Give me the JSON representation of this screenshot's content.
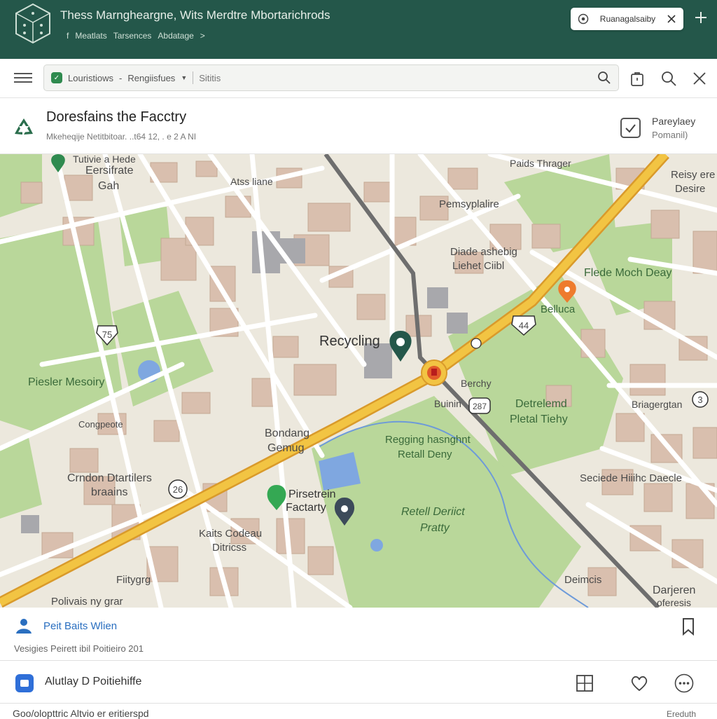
{
  "header": {
    "title": "Thess Marngheargne, Wits Merdtre Mbortarichrods",
    "menu": [
      "f",
      "Meatlats",
      "Tarsences",
      "Abdatage",
      ">"
    ],
    "tab_label": "Ruanagalsaiby",
    "tab_icon": "compass-icon",
    "close_icon": "close-icon",
    "plus_icon": "plus-icon"
  },
  "toolbar": {
    "search_category": "Louristiows",
    "search_sep": "-",
    "search_filter": "Rengiisfues",
    "search_placeholder": "Sititis",
    "icons": [
      "menu-icon",
      "search-icon",
      "bag-icon",
      "search-icon",
      "close-icon"
    ]
  },
  "place": {
    "title": "Doresfains the Facctry",
    "subtitle": "Mkeheqije Netitbitoar. ..t64 12, . e 2 A NI",
    "save_label_line1": "Pareylaey",
    "save_label_line2": "Pomanil)"
  },
  "map": {
    "labels": {
      "top_left_poi": "Tutivie a Hede",
      "estate": "Eersifrate",
      "estate2": "Gah",
      "atss": "Atss liane",
      "plaids": "Paids Thrager",
      "reisy": "Reisy ere",
      "desire": "Desire",
      "pemsy": "Pemsyplalire",
      "diade": "Diade ashebig",
      "liehet": "Liehet Ciibl",
      "flede": "Flede Moch Deay",
      "belluca": "Belluca",
      "recycling": "Recycling",
      "pieslet": "Piesler Mesoiry",
      "conpeote": "Congpeote",
      "bonding": "Bondang",
      "gemug": "Gemug",
      "berchy": "Berchy",
      "buinin": "Buinin",
      "detrelemd": "Detrelemd",
      "pletal": "Pletal Tiehy",
      "briagerstan": "Briagergtan",
      "regging": "Regging hasnghnt",
      "retall": "Retall Deny",
      "crndon": "Crndon Dtartilers",
      "brains": "braains",
      "pirsetrein": "Pirsetrein",
      "factarty": "Factarty",
      "retell_district": "Retell Deriict",
      "pratty": "Pratty",
      "kaits": "Kaits Codeau",
      "ditricss": "Ditricss",
      "fiitygrg": "Fiitygrg",
      "polivais": "Polivais ny grar",
      "seciede": "Seciede Hiiihc Daecle",
      "deimcis": "Deimcis",
      "darjeren": "Darjeren",
      "oferesis": "oferesis"
    },
    "shields": [
      "75",
      "44",
      "26",
      "287",
      "3"
    ]
  },
  "list": {
    "row1_title": "Peit Baits Wlien",
    "row1_sub": "Vesigies Peirett ibil Poitieiro 201",
    "row2_title": "Alutlay D Poitiehiffe"
  },
  "footer": {
    "left": "Goo/olopttric Altvio er eritierspd",
    "right": "Ereduth"
  }
}
